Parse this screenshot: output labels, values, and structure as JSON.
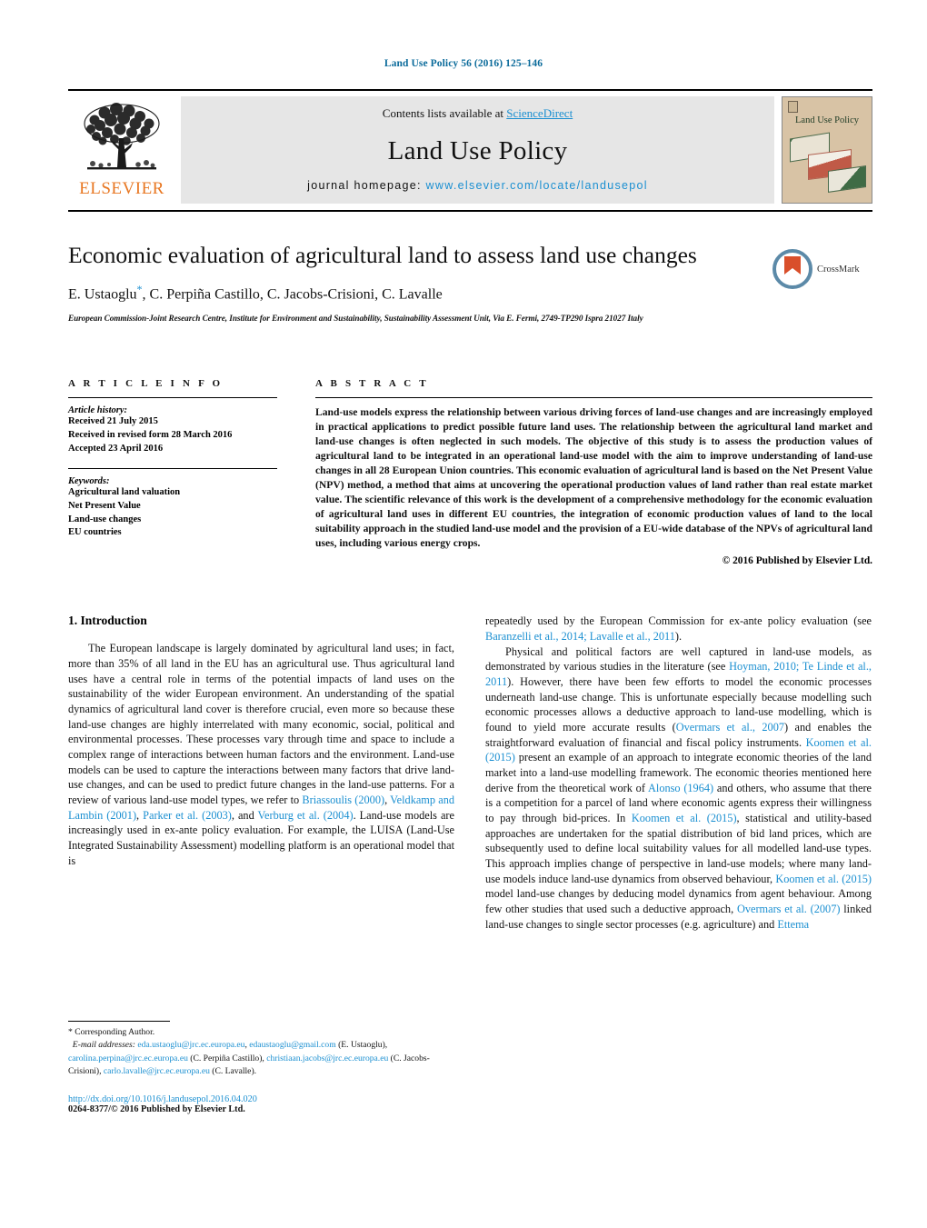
{
  "running_head": "Land Use Policy 56 (2016) 125–146",
  "masthead": {
    "publisher_name": "ELSEVIER",
    "contents_prefix": "Contents lists available at ",
    "contents_link": "ScienceDirect",
    "journal_title": "Land Use Policy",
    "homepage_prefix": "journal homepage: ",
    "homepage_url": "www.elsevier.com/locate/landusepol",
    "cover_title": "Land Use Policy"
  },
  "article": {
    "title": "Economic evaluation of agricultural land to assess land use changes",
    "authors": "E. Ustaoglu",
    "authors_rest": ", C. Perpiña Castillo, C. Jacobs-Crisioni, C. Lavalle",
    "corresponding_marker": "*",
    "affiliation": "European Commission-Joint Research Centre, Institute for Environment and Sustainability, Sustainability Assessment Unit, Via E. Fermi, 2749-TP290 Ispra 21027 Italy",
    "crossmark_label": "CrossMark"
  },
  "info": {
    "heading": "A R T I C L E   I N F O",
    "history_label": "Article history:",
    "history": [
      "Received 21 July 2015",
      "Received in revised form 28 March 2016",
      "Accepted 23 April 2016"
    ],
    "keywords_label": "Keywords:",
    "keywords": [
      "Agricultural land valuation",
      "Net Present Value",
      "Land-use changes",
      "EU countries"
    ]
  },
  "abstract": {
    "heading": "A B S T R A C T",
    "text": "Land-use models express the relationship between various driving forces of land-use changes and are increasingly employed in practical applications to predict possible future land uses. The relationship between the agricultural land market and land-use changes is often neglected in such models. The objective of this study is to assess the production values of agricultural land to be integrated in an operational land-use model with the aim to improve understanding of land-use changes in all 28 European Union countries. This economic evaluation of agricultural land is based on the Net Present Value (NPV) method, a method that aims at uncovering the operational production values of land rather than real estate market value. The scientific relevance of this work is the development of a comprehensive methodology for the economic evaluation of agricultural land uses in different EU countries, the integration of economic production values of land to the local suitability approach in the studied land-use model and the provision of a EU-wide database of the NPVs of agricultural land uses, including various energy crops.",
    "copyright": "© 2016 Published by Elsevier Ltd."
  },
  "body": {
    "section_heading": "1.  Introduction",
    "left_p1_a": "The European landscape is largely dominated by agricultural land uses; in fact, more than 35% of all land in the EU has an agricultural use. Thus agricultural land uses have a central role in terms of the potential impacts of land uses on the sustainability of the wider European environment. An understanding of the spatial dynamics of agricultural land cover is therefore crucial, even more so because these land-use changes are highly interrelated with many economic, social, political and environmental processes. These processes vary through time and space to include a complex range of interactions between human factors and the environment. Land-use models can be used to capture the interactions between many factors that drive land-use changes, and can be used to predict future changes in the land-use patterns. For a review of various land-use model types, we refer to ",
    "ref_briassoulis": "Briassoulis (2000)",
    "left_p1_b": ", ",
    "ref_veldkamp": "Veldkamp and Lambin (2001)",
    "left_p1_c": ", ",
    "ref_parker": "Parker et al. (2003)",
    "left_p1_d": ", and ",
    "ref_verburg": "Verburg et al. (2004)",
    "left_p1_e": ". Land-use models are increasingly used in ex-ante policy evaluation. For example, the LUISA (Land-Use Integrated Sustainability Assessment) modelling platform is an operational model that is ",
    "right_p0_a": "repeatedly used by the European Commission for ex-ante policy evaluation (see ",
    "ref_baranzelli": "Baranzelli et al., 2014; Lavalle et al., 2011",
    "right_p0_b": ").",
    "right_p1_a": "Physical and political factors are well captured in land-use models, as demonstrated by various studies in the literature (see ",
    "ref_hoyman": "Hoyman, 2010; Te Linde et al., 2011",
    "right_p1_b": "). However, there have been few efforts to model the economic processes underneath land-use change. This is unfortunate especially because modelling such economic processes allows a deductive approach to land-use modelling, which is found to yield more accurate results (",
    "ref_overmars": "Overmars et al., 2007",
    "right_p1_c": ") and enables the straightforward evaluation of financial and fiscal policy instruments. ",
    "ref_koomen1": "Koomen et al. (2015)",
    "right_p1_d": " present an example of an approach to integrate economic theories of the land market into a land-use modelling framework. The economic theories mentioned here derive from the theoretical work of ",
    "ref_alonso": "Alonso (1964)",
    "right_p1_e": " and others, who assume that there is a competition for a parcel of land where economic agents express their willingness to pay through bid-prices. In ",
    "ref_koomen2": "Koomen et al. (2015)",
    "right_p1_f": ", statistical and utility-based approaches are undertaken for the spatial distribution of bid land prices, which are subsequently used to define local suitability values for all modelled land-use types. This approach implies change of perspective in land-use models; where many land-use models induce land-use dynamics from observed behaviour, ",
    "ref_koomen3": "Koomen et al. (2015)",
    "right_p1_g": " model land-use changes by deducing model dynamics from agent behaviour. Among few other studies that used such a deductive approach, ",
    "ref_overmars2": "Overmars et al. (2007)",
    "right_p1_h": " linked land-use changes to single sector processes (e.g. agriculture) and ",
    "ref_ettema": "Ettema"
  },
  "footnotes": {
    "corresponding": "*  Corresponding Author.",
    "email_label": "E-mail addresses:",
    "email_1": "eda.ustaoglu@jrc.ec.europa.eu",
    "email_1b": "edaustaoglu@gmail.com",
    "email_1_owner": "(E. Ustaoglu), ",
    "email_2": "carolina.perpina@jrc.ec.europa.eu",
    "email_2_owner": " (C. Perpiña Castillo),",
    "email_3": "christiaan.jacobs@jrc.ec.europa.eu",
    "email_3_owner": " (C. Jacobs-Crisioni),",
    "email_4": "carlo.lavalle@jrc.ec.europa.eu",
    "email_4_owner": " (C. Lavalle).",
    "doi": "http://dx.doi.org/10.1016/j.landusepol.2016.04.020",
    "issn": "0264-8377/© 2016 Published by Elsevier Ltd."
  },
  "colors": {
    "link_blue": "#1a8fd1",
    "runhead_blue": "#0b6b9b",
    "elsevier_orange": "#E87722",
    "masthead_gray": "#e6e6e6",
    "cover_tan": "#d8c3a5"
  }
}
